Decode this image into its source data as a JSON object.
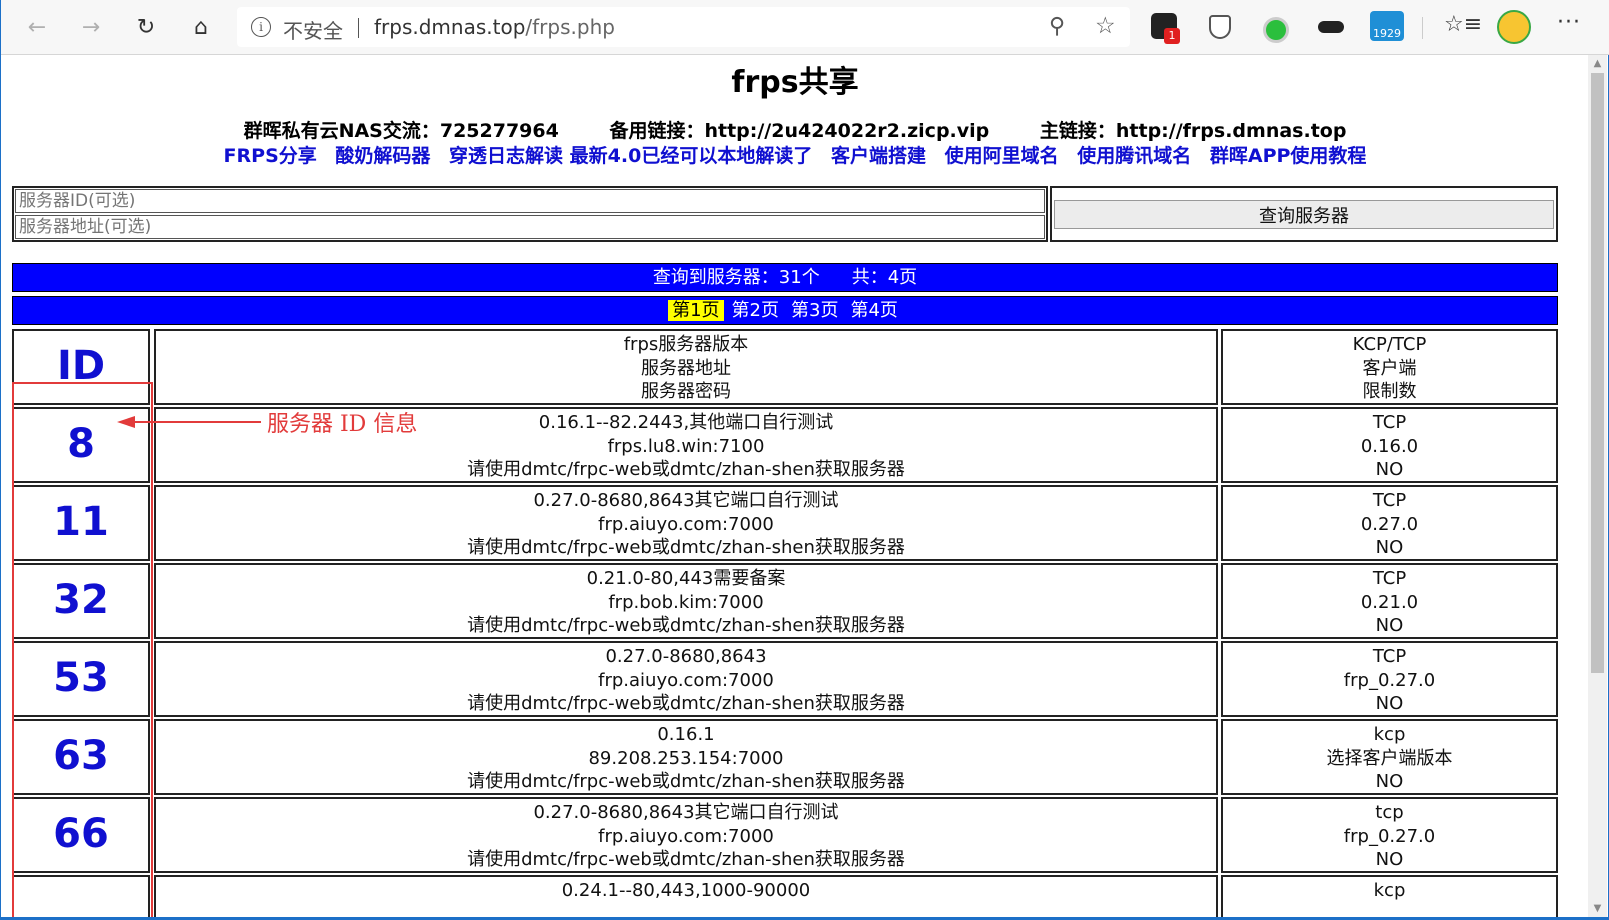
{
  "browser": {
    "security_label": "不安全",
    "url_host": "frps.dmnas.top",
    "url_path": "/frps.php",
    "ext_badge_count": "1",
    "ext_counter": "1929"
  },
  "page": {
    "title": "frps共享",
    "info": {
      "qq_group": "群晖私有云NAS交流：725277964",
      "backup_link": "备用链接：http://2u424022r2.zicp.vip",
      "main_link": "主链接：http://frps.dmnas.top"
    },
    "links": [
      "FRPS分享",
      "酸奶解码器",
      "穿透日志解读 最新4.0已经可以本地解读了",
      "客户端搭建",
      "使用阿里域名",
      "使用腾讯域名",
      "群晖APP使用教程"
    ],
    "search": {
      "id_placeholder": "服务器ID(可选)",
      "addr_placeholder": "服务器地址(可选)",
      "query_button": "查询服务器"
    },
    "summary": {
      "found": "查询到服务器：31个",
      "total_pages": "共：4页"
    },
    "pager": [
      "第1页",
      "第2页",
      "第3页",
      "第4页"
    ],
    "current_page": "第1页"
  },
  "table": {
    "header": {
      "id": "ID",
      "info": [
        "frps服务器版本",
        "服务器地址",
        "服务器密码"
      ],
      "meta": [
        "KCP/TCP",
        "客户端",
        "限制数"
      ]
    },
    "rows": [
      {
        "id": "8",
        "info": [
          "0.16.1--82.2443,其他端口自行测试",
          "frps.lu8.win:7100",
          "请使用dmtc/frpc-web或dmtc/zhan-shen获取服务器"
        ],
        "meta": [
          "TCP",
          "0.16.0",
          "NO"
        ]
      },
      {
        "id": "11",
        "info": [
          "0.27.0-8680,8643其它端口自行测试",
          "frp.aiuyo.com:7000",
          "请使用dmtc/frpc-web或dmtc/zhan-shen获取服务器"
        ],
        "meta": [
          "TCP",
          "0.27.0",
          "NO"
        ]
      },
      {
        "id": "32",
        "info": [
          "0.21.0-80,443需要备案",
          "frp.bob.kim:7000",
          "请使用dmtc/frpc-web或dmtc/zhan-shen获取服务器"
        ],
        "meta": [
          "TCP",
          "0.21.0",
          "NO"
        ]
      },
      {
        "id": "53",
        "info": [
          "0.27.0-8680,8643",
          "frp.aiuyo.com:7000",
          "请使用dmtc/frpc-web或dmtc/zhan-shen获取服务器"
        ],
        "meta": [
          "TCP",
          "frp_0.27.0",
          "NO"
        ]
      },
      {
        "id": "63",
        "info": [
          "0.16.1",
          "89.208.253.154:7000",
          "请使用dmtc/frpc-web或dmtc/zhan-shen获取服务器"
        ],
        "meta": [
          "kcp",
          "选择客户端版本",
          "NO"
        ]
      },
      {
        "id": "66",
        "info": [
          "0.27.0-8680,8643其它端口自行测试",
          "frp.aiuyo.com:7000",
          "请使用dmtc/frpc-web或dmtc/zhan-shen获取服务器"
        ],
        "meta": [
          "tcp",
          "frp_0.27.0",
          "NO"
        ]
      },
      {
        "id": "",
        "info": [
          "0.24.1--80,443,1000-90000",
          "",
          ""
        ],
        "meta": [
          "kcp",
          "",
          ""
        ]
      }
    ]
  },
  "annotation": {
    "text": "服务器 ID 信息",
    "color": "#e23b3b"
  },
  "colors": {
    "bar_blue": "#0000ff",
    "link_blue": "#1010d0",
    "pager_highlight": "#ffff00"
  }
}
